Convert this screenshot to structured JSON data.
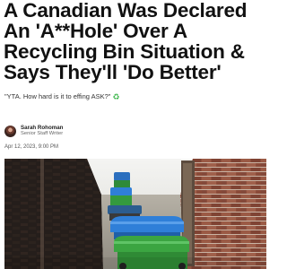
{
  "article": {
    "headline": "A Canadian Was Declared An 'A**Hole' Over A Recycling Bin Situation & Says They'll 'Do Better'",
    "dek": "\"YTA. How hard is it to effing ASK?\"",
    "dek_icon": "recycle-icon",
    "author_name": "Sarah Rohoman",
    "author_role": "Senior Staff Writer",
    "date": "Apr 12, 2023, 9:00 PM"
  },
  "colors": {
    "headline": "#111111",
    "accent_green": "#3bb54a",
    "bin_blue": "#2f7fd8",
    "bin_green": "#3ba541",
    "brick": "#8d4e3c"
  }
}
